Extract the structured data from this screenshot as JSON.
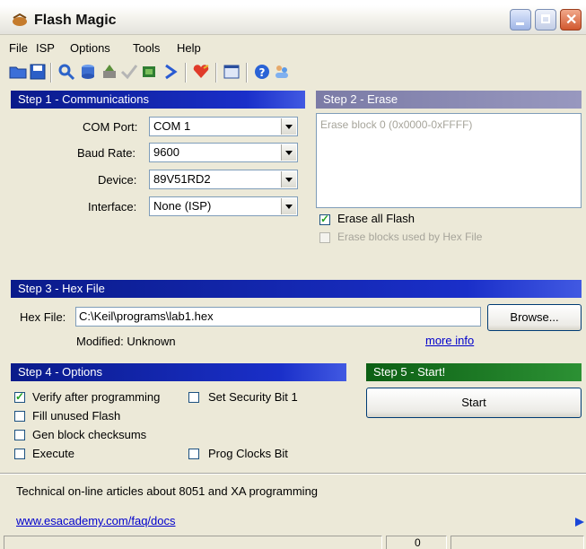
{
  "window": {
    "title": "Flash Magic"
  },
  "menu": [
    {
      "label": "File"
    },
    {
      "label": "ISP"
    },
    {
      "label": "Options"
    },
    {
      "label": "Tools"
    },
    {
      "label": "Help"
    }
  ],
  "toolbar_icons": [
    "open-folder-icon",
    "save-icon",
    "search-icon",
    "database-icon",
    "erase-icon",
    "verify-check-icon",
    "program-chip-icon",
    "go-arrow-icon",
    "heart-icon",
    "window-icon",
    "help-icon",
    "users-icon"
  ],
  "step1": {
    "title": "Step 1 - Communications",
    "com_port_label": "COM Port:",
    "com_port_value": "COM 1",
    "baud_label": "Baud Rate:",
    "baud_value": "9600",
    "device_label": "Device:",
    "device_value": "89V51RD2",
    "interface_label": "Interface:",
    "interface_value": "None (ISP)"
  },
  "step2": {
    "title": "Step 2 - Erase",
    "list_item": "Erase block 0 (0x0000-0xFFFF)",
    "erase_all_label": "Erase all Flash",
    "erase_blocks_label": "Erase blocks used by Hex File"
  },
  "step3": {
    "title": "Step 3 - Hex File",
    "hex_label": "Hex File:",
    "hex_value": "C:\\Keil\\programs\\lab1.hex",
    "browse_label": "Browse...",
    "modified_text": "Modified: Unknown",
    "more_info": "more info"
  },
  "step4": {
    "title": "Step 4 - Options",
    "verify_label": "Verify after programming",
    "fill_label": "Fill unused Flash",
    "gen_label": "Gen block checksums",
    "execute_label": "Execute",
    "security_label": "Set Security Bit 1",
    "clocks_label": "Prog Clocks Bit"
  },
  "step5": {
    "title": "Step 5 - Start!",
    "start_label": "Start"
  },
  "footer": {
    "info_text": "Technical on-line articles about 8051 and XA programming",
    "link": "www.esacademy.com/faq/docs"
  },
  "status": {
    "count": "0"
  }
}
